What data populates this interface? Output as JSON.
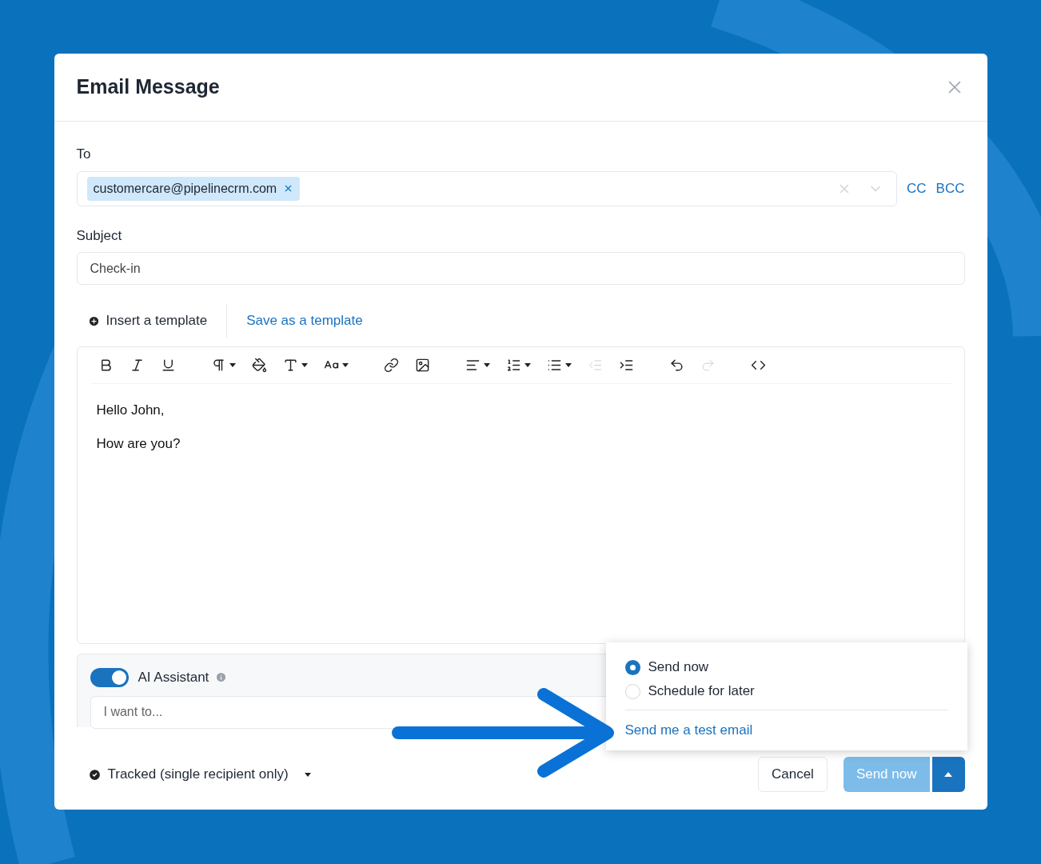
{
  "window": {
    "title": "Email Message"
  },
  "to": {
    "label": "To",
    "chips": [
      {
        "text": "customercare@pipelinecrm.com"
      }
    ],
    "cc": "CC",
    "bcc": "BCC"
  },
  "subject": {
    "label": "Subject",
    "value": "Check-in"
  },
  "template": {
    "insert": "Insert a template",
    "save": "Save as a template"
  },
  "toolbar": [
    {
      "kind": "bold",
      "disabled": false,
      "dropdown": false
    },
    {
      "kind": "italic",
      "disabled": false,
      "dropdown": false
    },
    {
      "kind": "underline",
      "disabled": false,
      "dropdown": false
    },
    {
      "kind": "paragraph",
      "disabled": false,
      "dropdown": true
    },
    {
      "kind": "color",
      "disabled": false,
      "dropdown": false
    },
    {
      "kind": "font",
      "disabled": false,
      "dropdown": true
    },
    {
      "kind": "size",
      "disabled": false,
      "dropdown": true
    },
    {
      "kind": "link",
      "disabled": false,
      "dropdown": false
    },
    {
      "kind": "image",
      "disabled": false,
      "dropdown": false
    },
    {
      "kind": "align",
      "disabled": false,
      "dropdown": true
    },
    {
      "kind": "ordered",
      "disabled": false,
      "dropdown": true
    },
    {
      "kind": "bullets",
      "disabled": false,
      "dropdown": true
    },
    {
      "kind": "outdent",
      "disabled": true,
      "dropdown": false
    },
    {
      "kind": "indent",
      "disabled": false,
      "dropdown": false
    },
    {
      "kind": "undo",
      "disabled": false,
      "dropdown": false
    },
    {
      "kind": "redo",
      "disabled": true,
      "dropdown": false
    },
    {
      "kind": "code",
      "disabled": false,
      "dropdown": false
    }
  ],
  "body": [
    "Hello John,",
    "How are you?"
  ],
  "ai": {
    "on": true,
    "label": "AI Assistant",
    "placeholder": "I want to..."
  },
  "tracking": {
    "label": "Tracked (single recipient only)"
  },
  "send_menu": {
    "options": [
      {
        "label": "Send now",
        "selected": true
      },
      {
        "label": "Schedule for later",
        "selected": false
      }
    ],
    "test_link": "Send me a test email"
  },
  "buttons": {
    "cancel": "Cancel",
    "send": "Send now",
    "send_disabled": true
  }
}
